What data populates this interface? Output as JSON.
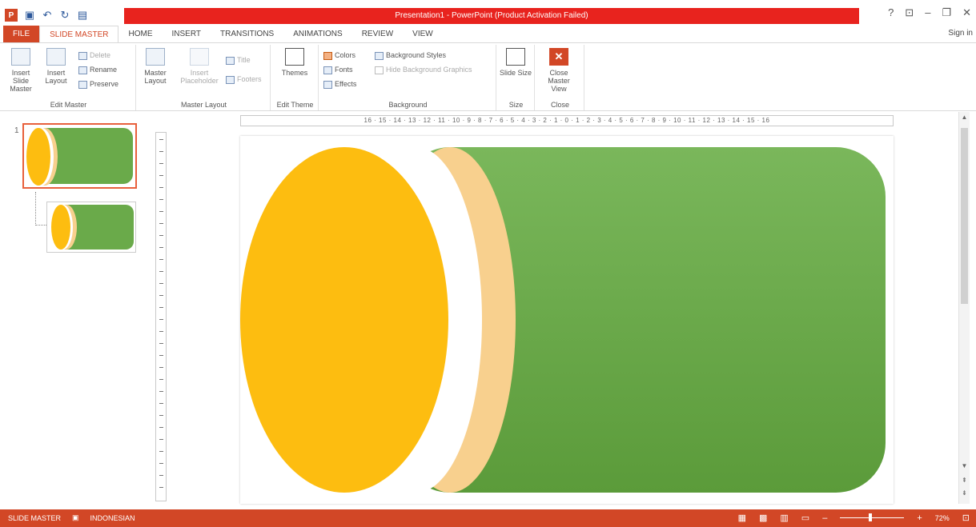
{
  "window": {
    "title": "Presentation1 - PowerPoint (Product Activation Failed)",
    "controls": [
      "?",
      "⊡",
      "–",
      "❐",
      "✕"
    ],
    "sign_in": "Sign in"
  },
  "tabs": [
    {
      "label": "FILE"
    },
    {
      "label": "SLIDE MASTER"
    },
    {
      "label": "HOME"
    },
    {
      "label": "INSERT"
    },
    {
      "label": "TRANSITIONS"
    },
    {
      "label": "ANIMATIONS"
    },
    {
      "label": "REVIEW"
    },
    {
      "label": "VIEW"
    }
  ],
  "ribbon": {
    "edit_master": {
      "label": "Edit Master",
      "insert_slide_master": "Insert Slide Master",
      "insert_layout": "Insert Layout",
      "delete": "Delete",
      "rename": "Rename",
      "preserve": "Preserve"
    },
    "master_layout": {
      "label": "Master Layout",
      "master_layout_btn": "Master Layout",
      "insert_placeholder": "Insert Placeholder",
      "title": "Title",
      "footers": "Footers"
    },
    "edit_theme": {
      "label": "Edit Theme",
      "themes": "Themes"
    },
    "background": {
      "label": "Background",
      "colors": "Colors",
      "fonts": "Fonts",
      "effects": "Effects",
      "background_styles": "Background Styles",
      "hide_background_graphics": "Hide Background Graphics"
    },
    "size": {
      "label": "Size",
      "slide_size": "Slide Size"
    },
    "close": {
      "label": "Close",
      "close_master_view": "Close Master View"
    }
  },
  "thumbnails": {
    "number": "1"
  },
  "ruler": {
    "text": "16 · 15 · 14 · 13 · 12 · 11 · 10 · 9 · 8 · 7 · 6 · 5 · 4 · 3 · 2 · 1 · 0 · 1 · 2 · 3 · 4 · 5 · 6 · 7 · 8 · 9 · 10 · 11 · 12 · 13 · 14 · 15 · 16"
  },
  "slide": {
    "colors": {
      "orange": "#fdbd10",
      "light_orange": "#f8d08e",
      "green_top": "#7ab75b",
      "green_bottom": "#5b9b3a",
      "white": "#ffffff"
    }
  },
  "status": {
    "mode": "SLIDE MASTER",
    "language": "INDONESIAN",
    "zoom": "72%"
  },
  "colors": {
    "accent": "#d24726",
    "titlebar_red": "#e8231e"
  }
}
